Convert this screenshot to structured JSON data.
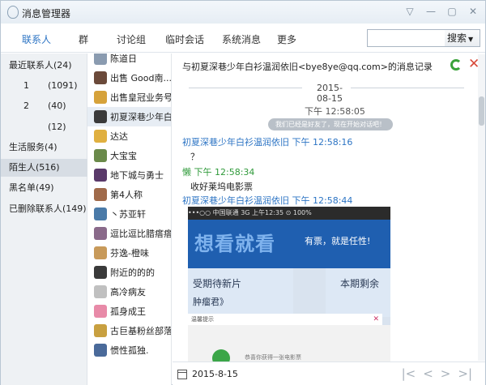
{
  "window": {
    "title": "消息管理器",
    "controls": [
      "▽",
      "—",
      "▢",
      "✕"
    ]
  },
  "nav": {
    "tabs": [
      {
        "label": "联系人",
        "active": true
      },
      {
        "label": "群",
        "active": false
      },
      {
        "label": "讨论组",
        "active": false
      },
      {
        "label": "临时会话",
        "active": false
      },
      {
        "label": "系统消息",
        "active": false
      },
      {
        "label": "更多",
        "active": false
      }
    ],
    "search_placeholder": "",
    "search_button": "搜索"
  },
  "categories": [
    {
      "label": "最近联系人(24)"
    },
    {
      "key": "1",
      "count": "(1091)"
    },
    {
      "key": "2",
      "count": "(40)"
    },
    {
      "key": "",
      "count": "(12)"
    },
    {
      "label": "生活服务(4)"
    },
    {
      "label": "陌生人(516)",
      "selected": true
    },
    {
      "label": "黑名单(49)"
    },
    {
      "label": "已删除联系人(149)"
    }
  ],
  "contacts": [
    {
      "name": "陈道日",
      "color": "#8a9bb0"
    },
    {
      "name": "出售 Good南...",
      "color": "#6b4a3a"
    },
    {
      "name": "出售皇冠业务号",
      "color": "#d6a23a"
    },
    {
      "name": "初夏深巷少年白...",
      "color": "#3a3a3a",
      "selected": true
    },
    {
      "name": "达达",
      "color": "#e0b040"
    },
    {
      "name": "大宝宝",
      "color": "#6a8a4a"
    },
    {
      "name": "地下城与勇士",
      "color": "#5a3a6a"
    },
    {
      "name": "第4人称",
      "color": "#a06a4a"
    },
    {
      "name": "丶苏亚轩",
      "color": "#4a7aa8"
    },
    {
      "name": "逗比逗比腊瘩瘩",
      "color": "#8a6a8a"
    },
    {
      "name": "芬逸-橙味",
      "color": "#c89a5a"
    },
    {
      "name": "附近的的的",
      "color": "#3a3a3a"
    },
    {
      "name": "高冷病友",
      "color": "#c0c0c0"
    },
    {
      "name": "孤身成王",
      "color": "#e88aa8"
    },
    {
      "name": "古巨基粉丝部落",
      "color": "#c8a040"
    },
    {
      "name": "惯性孤独.",
      "color": "#4a6a9a"
    }
  ],
  "chat": {
    "header": "与初夏深巷少年白衫温润依旧<bye8ye@qq.com>的消息记录",
    "date": "2015-08-15",
    "system_time": "下午 12:58:05",
    "system_msg": "我们已经是好友了，现在开始对话吧！",
    "messages": [
      {
        "sender": "初夏深巷少年白衫温润依旧 下午 12:58:16",
        "text": "？",
        "green": false
      },
      {
        "sender": "懒 下午 12:58:34",
        "text": "收好莱坞电影票",
        "green": true
      },
      {
        "sender": "初夏深巷少年白衫温润依旧 下午 12:58:44",
        "text": "",
        "green": false
      }
    ],
    "photo": {
      "status": "•••○○ 中国联通  3G   上午12:35        ⊙ 100%",
      "big_text": "想看就看",
      "small_text": "有票，就是任性!",
      "card1": "受期待新片",
      "card1_sub": "肿瘤君》",
      "card2": "本期剩余",
      "dialog": "温馨提示",
      "dialog_close": "✕",
      "bottom_text": "恭喜你获得一张电影票"
    }
  },
  "footer": {
    "date": "2015-8-15",
    "pager": [
      "|<",
      "<",
      ">",
      ">|"
    ]
  },
  "colors": {
    "accent": "#2c74c4",
    "green": "#2f9a3a",
    "red": "#d84a3a"
  }
}
